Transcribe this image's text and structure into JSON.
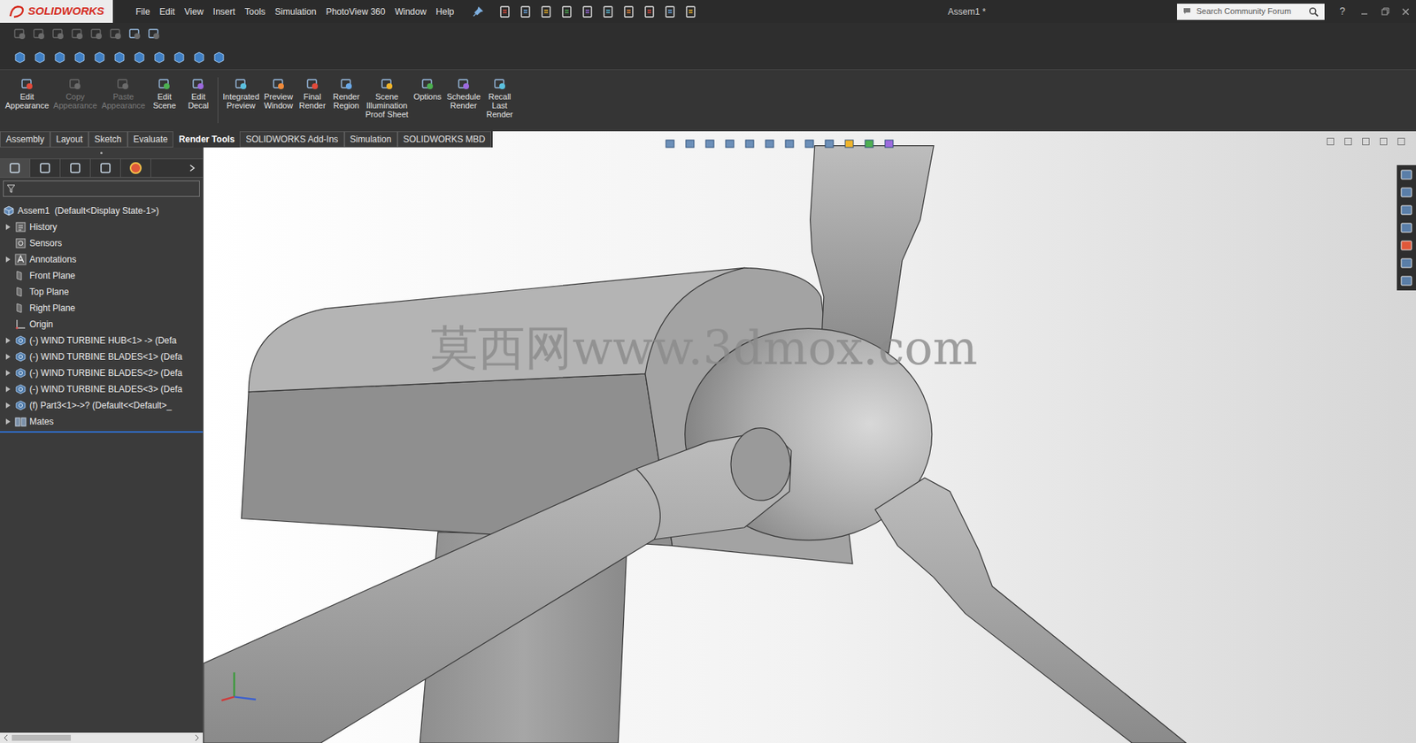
{
  "window": {
    "title": "Assem1 *"
  },
  "app": {
    "logo": "SOLIDWORKS"
  },
  "menu": [
    "File",
    "Edit",
    "View",
    "Insert",
    "Tools",
    "Simulation",
    "PhotoView 360",
    "Window",
    "Help"
  ],
  "search": {
    "placeholder": "Search Community Forum"
  },
  "help": "?",
  "command_manager": {
    "buttons": [
      {
        "label": [
          "Edit",
          "Appearance"
        ],
        "disabled": false
      },
      {
        "label": [
          "Copy",
          "Appearance"
        ],
        "disabled": true
      },
      {
        "label": [
          "Paste",
          "Appearance"
        ],
        "disabled": true
      },
      {
        "label": [
          "Edit",
          "Scene"
        ],
        "disabled": false
      },
      {
        "label": [
          "Edit",
          "Decal"
        ],
        "disabled": false
      },
      {
        "label": [
          "Integrated",
          "Preview"
        ],
        "disabled": false
      },
      {
        "label": [
          "Preview",
          "Window"
        ],
        "disabled": false
      },
      {
        "label": [
          "Final",
          "Render"
        ],
        "disabled": false
      },
      {
        "label": [
          "Render",
          "Region"
        ],
        "disabled": false
      },
      {
        "label": [
          "Scene",
          "Illumination",
          "Proof Sheet"
        ],
        "disabled": false
      },
      {
        "label": [
          "Options"
        ],
        "disabled": false
      },
      {
        "label": [
          "Schedule",
          "Render"
        ],
        "disabled": false
      },
      {
        "label": [
          "Recall",
          "Last",
          "Render"
        ],
        "disabled": false
      }
    ]
  },
  "tabs": [
    {
      "label": "Assembly",
      "selected": false
    },
    {
      "label": "Layout",
      "selected": false
    },
    {
      "label": "Sketch",
      "selected": false
    },
    {
      "label": "Evaluate",
      "selected": false
    },
    {
      "label": "Render Tools",
      "selected": true
    },
    {
      "label": "SOLIDWORKS Add-Ins",
      "selected": false
    },
    {
      "label": "Simulation",
      "selected": false
    },
    {
      "label": "SOLIDWORKS MBD",
      "selected": false
    }
  ],
  "feature_tree": {
    "items": [
      {
        "label": "Assem1  (Default<Display State-1>)",
        "kind": "root",
        "expandable": false
      },
      {
        "label": "History",
        "kind": "history",
        "expandable": true
      },
      {
        "label": "Sensors",
        "kind": "sensors",
        "expandable": false
      },
      {
        "label": "Annotations",
        "kind": "annotations",
        "expandable": true
      },
      {
        "label": "Front Plane",
        "kind": "plane",
        "expandable": false
      },
      {
        "label": "Top Plane",
        "kind": "plane",
        "expandable": false
      },
      {
        "label": "Right Plane",
        "kind": "plane",
        "expandable": false
      },
      {
        "label": "Origin",
        "kind": "origin",
        "expandable": false
      },
      {
        "label": "(-) WIND TURBINE HUB<1> -> (Defa",
        "kind": "part",
        "expandable": true
      },
      {
        "label": "(-) WIND TURBINE BLADES<1> (Defa",
        "kind": "part",
        "expandable": true
      },
      {
        "label": "(-) WIND TURBINE BLADES<2> (Defa",
        "kind": "part",
        "expandable": true
      },
      {
        "label": "(-) WIND TURBINE BLADES<3> (Defa",
        "kind": "part",
        "expandable": true
      },
      {
        "label": "(f) Part3<1>->? (Default<<Default>_",
        "kind": "part",
        "expandable": true
      },
      {
        "label": "Mates",
        "kind": "mates",
        "expandable": true
      }
    ]
  },
  "viewport": {
    "watermark": "莫西网www.3dmox.com"
  }
}
